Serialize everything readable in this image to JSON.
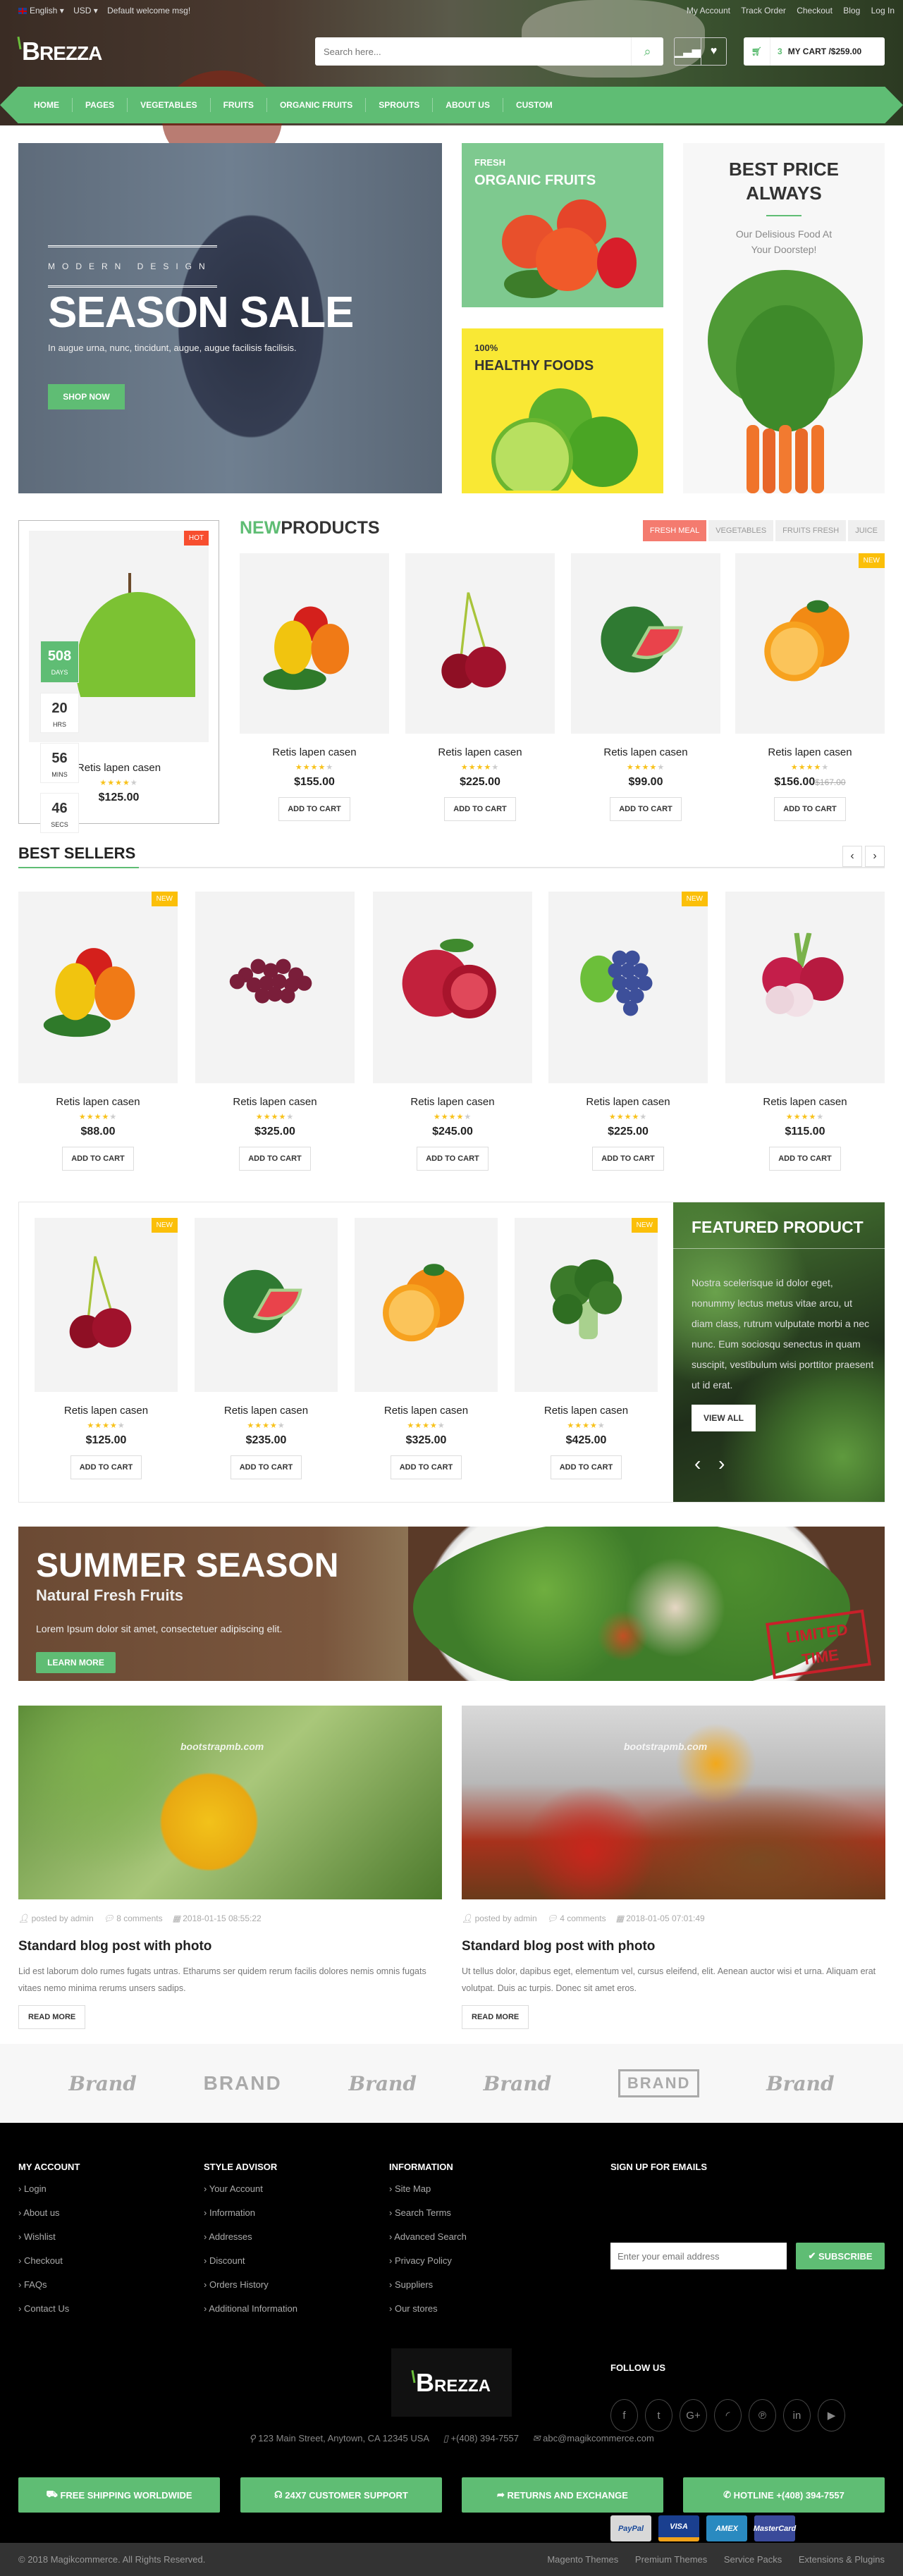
{
  "topbar": {
    "language": "English",
    "currency": "USD",
    "welcome": "Default welcome msg!",
    "links": [
      "My Account",
      "Track Order",
      "Checkout",
      "Blog",
      "Log In"
    ]
  },
  "header": {
    "logo": "BREZZA",
    "search_placeholder": "Search here...",
    "cart_count": "3",
    "cart_label": "MY CART /$259.00"
  },
  "nav": [
    "HOME",
    "PAGES",
    "VEGETABLES",
    "FRUITS",
    "ORGANIC FRUITS",
    "SPROUTS",
    "ABOUT US",
    "CUSTOM"
  ],
  "hero": {
    "main": {
      "kicker": "MODERN DESIGN",
      "title": "SEASON SALE",
      "text": "In augue urna, nunc, tincidunt, augue, augue facilisis facilisis.",
      "button": "SHOP NOW"
    },
    "fruits": {
      "kicker": "FRESH",
      "title": "ORGANIC FRUITS"
    },
    "healthy": {
      "kicker": "100%",
      "title": "HEALTHY FOODS"
    },
    "best_price": {
      "title": "BEST PRICE ALWAYS",
      "text": "Our Delisious Food At Your Doorstep!"
    }
  },
  "add_to_cart": "ADD TO CART",
  "deal": {
    "badge": "HOT",
    "countdown": [
      {
        "value": "508",
        "unit": "DAYS"
      },
      {
        "value": "20",
        "unit": "HRS"
      },
      {
        "value": "56",
        "unit": "MINS"
      },
      {
        "value": "46",
        "unit": "SECS"
      }
    ],
    "name": "Retis lapen casen",
    "rating": 4,
    "price": "$125.00",
    "image": "green-apple"
  },
  "new_products": {
    "title_accent": "NEW",
    "title": "PRODUCTS",
    "tabs": [
      "FRESH MEAL",
      "VEGETABLES",
      "FRUITS FRESH",
      "JUICE"
    ],
    "active_tab": "FRESH MEAL",
    "items": [
      {
        "name": "Retis lapen casen",
        "rating": 4,
        "price": "$155.00",
        "image": "bell-peppers"
      },
      {
        "name": "Retis lapen casen",
        "rating": 4,
        "price": "$225.00",
        "image": "cherries"
      },
      {
        "name": "Retis lapen casen",
        "rating": 4,
        "price": "$99.00",
        "image": "watermelon"
      },
      {
        "name": "Retis lapen casen",
        "rating": 4,
        "price": "$156.00",
        "old_price": "$167.00",
        "badge": "NEW",
        "image": "oranges"
      }
    ]
  },
  "best_sellers": {
    "title": "BEST SELLERS",
    "items": [
      {
        "name": "Retis lapen casen",
        "rating": 4,
        "price": "$88.00",
        "badge": "NEW",
        "image": "bell-peppers"
      },
      {
        "name": "Retis lapen casen",
        "rating": 4,
        "price": "$325.00",
        "image": "red-grapes"
      },
      {
        "name": "Retis lapen casen",
        "rating": 4,
        "price": "$245.00",
        "image": "pomegranate"
      },
      {
        "name": "Retis lapen casen",
        "rating": 4,
        "price": "$225.00",
        "badge": "NEW",
        "image": "blue-grapes"
      },
      {
        "name": "Retis lapen casen",
        "rating": 4,
        "price": "$115.00",
        "image": "radish"
      }
    ]
  },
  "featured": {
    "title": "FEATURED PRODUCT",
    "text": "Nostra scelerisque id dolor eget, nonummy lectus metus vitae arcu, ut diam class, rutrum vulputate morbi a nec nunc. Eum sociosqu senectus in quam suscipit, vestibulum wisi porttitor praesent ut id erat.",
    "button": "VIEW ALL",
    "items": [
      {
        "name": "Retis lapen casen",
        "rating": 4,
        "price": "$125.00",
        "badge": "NEW",
        "image": "cherries"
      },
      {
        "name": "Retis lapen casen",
        "rating": 4,
        "price": "$235.00",
        "image": "watermelon"
      },
      {
        "name": "Retis lapen casen",
        "rating": 4,
        "price": "$325.00",
        "image": "oranges"
      },
      {
        "name": "Retis lapen casen",
        "rating": 4,
        "price": "$425.00",
        "badge": "NEW",
        "image": "broccoli"
      }
    ]
  },
  "summer": {
    "title": "SUMMER SEASON",
    "subtitle": "Natural Fresh Fruits",
    "text": "Lorem Ipsum dolor sit amet, consectetuer adipiscing elit.",
    "button": "LEARN MORE",
    "stamp": "LIMITED TIME"
  },
  "blog": [
    {
      "watermark": "bootstrapmb.com",
      "author": "posted by admin",
      "comments": "8 comments",
      "date": "2018-01-15 08:55:22",
      "title": "Standard blog post with photo",
      "excerpt": "Lid est laborum dolo rumes fugats untras. Etharums ser quidem rerum facilis dolores nemis omnis fugats vitaes nemo minima rerums unsers sadips.",
      "button": "READ MORE"
    },
    {
      "watermark": "bootstrapmb.com",
      "author": "posted by admin",
      "comments": "4 comments",
      "date": "2018-01-05 07:01:49",
      "title": "Standard blog post with photo",
      "excerpt": "Ut tellus dolor, dapibus eget, elementum vel, cursus eleifend, elit. Aenean auctor wisi et urna. Aliquam erat volutpat. Duis ac turpis. Donec sit amet eros.",
      "button": "READ MORE"
    }
  ],
  "brands": [
    "Brand",
    "BRAND",
    "Brand",
    "Brand",
    "BRAND",
    "Brand"
  ],
  "footer": {
    "columns": [
      {
        "title": "MY ACCOUNT",
        "links": [
          "Login",
          "About us",
          "Wishlist",
          "Checkout",
          "FAQs",
          "Contact Us"
        ]
      },
      {
        "title": "STYLE ADVISOR",
        "links": [
          "Your Account",
          "Information",
          "Addresses",
          "Discount",
          "Orders History",
          "Additional Information"
        ]
      },
      {
        "title": "INFORMATION",
        "links": [
          "Site Map",
          "Search Terms",
          "Advanced Search",
          "Privacy Policy",
          "Suppliers",
          "Our stores"
        ]
      }
    ],
    "signup_title": "SIGN UP FOR EMAILS",
    "email_placeholder": "Enter your email address",
    "subscribe": "SUBSCRIBE",
    "follow_title": "FOLLOW US",
    "social": [
      "facebook",
      "twitter",
      "google-plus",
      "rss",
      "pinterest",
      "linkedin",
      "youtube"
    ],
    "payments": [
      "PayPal",
      "VISA",
      "AMEX",
      "MasterCard"
    ],
    "logo": "BREZZA",
    "address": "123 Main Street, Anytown, CA 12345 USA",
    "phone": "+(408) 394-7557",
    "email": "abc@magikcommerce.com",
    "features": [
      "FREE SHIPPING WORLDWIDE",
      "24X7 CUSTOMER SUPPORT",
      "RETURNS AND EXCHANGE",
      "HOTLINE +(408) 394-7557"
    ],
    "copyright": "© 2018 Magikcommerce. All Rights Reserved.",
    "bottom_links": [
      "Magento Themes",
      "Premium Themes",
      "Service Packs",
      "Extensions & Plugins"
    ]
  },
  "colors": {
    "accent": "#5fbd74",
    "new_badge": "#fbbf09",
    "hot_badge": "#f74e2f",
    "tab_active": "#f47b6f"
  }
}
